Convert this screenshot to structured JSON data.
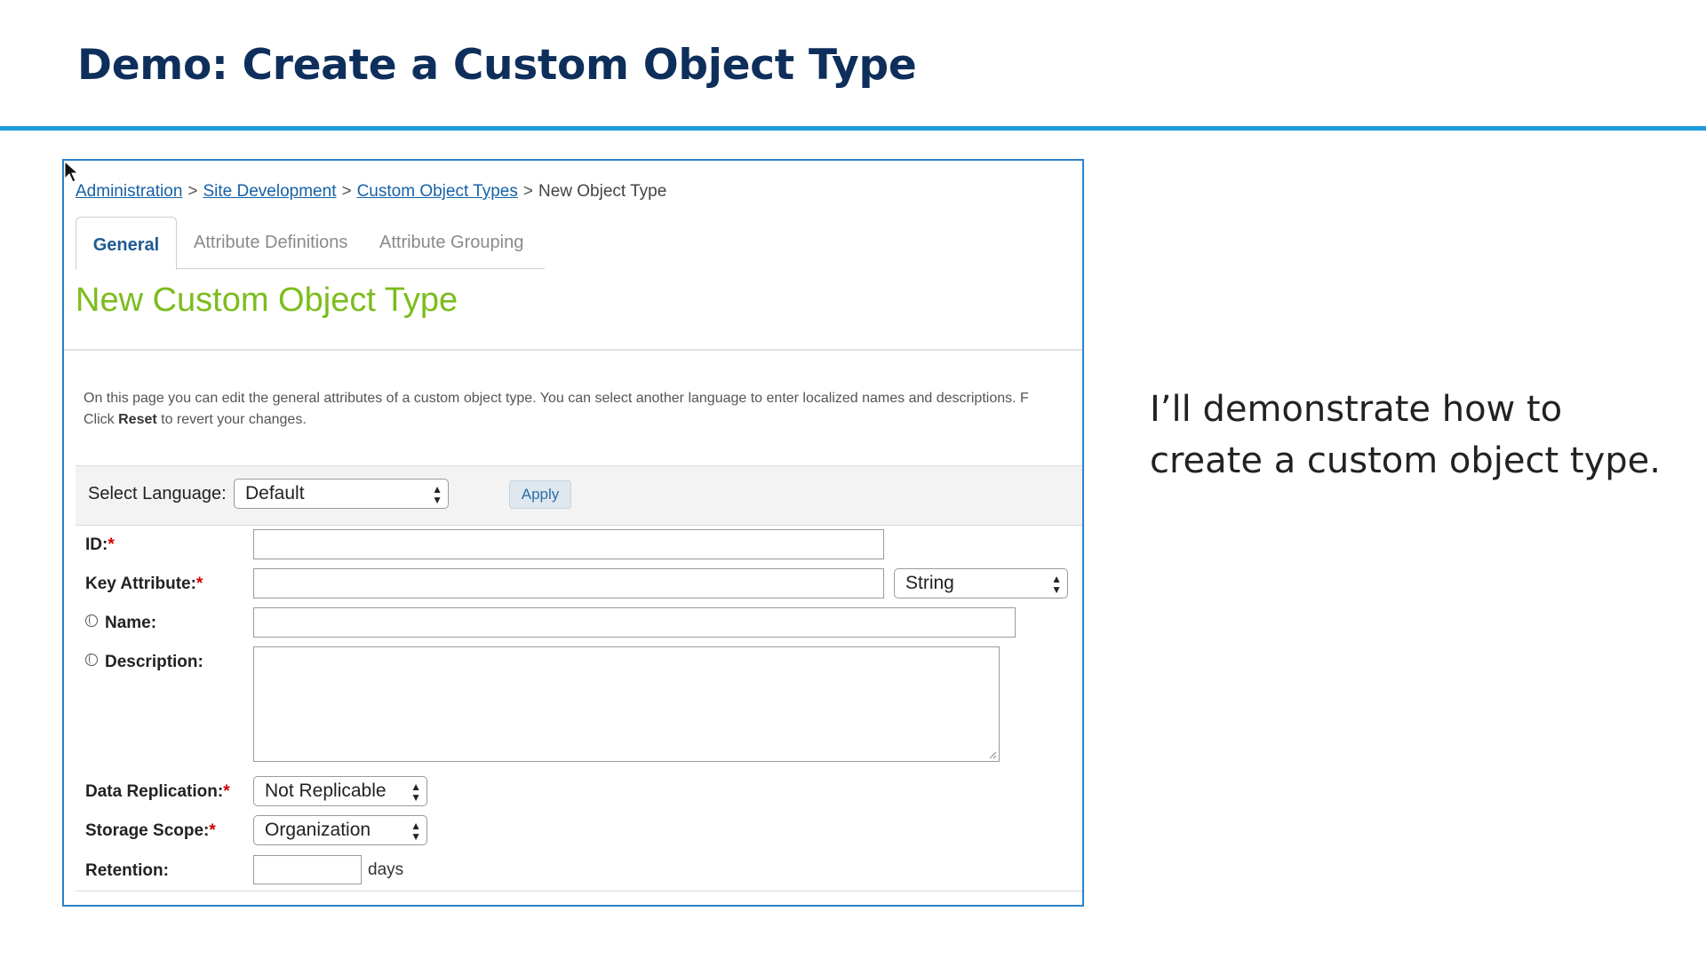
{
  "slide": {
    "title": "Demo: Create a Custom Object Type",
    "side_text": "I’ll demonstrate how to create a custom object type."
  },
  "breadcrumb": {
    "items": [
      "Administration",
      "Site Development",
      "Custom Object Types"
    ],
    "current": "New Object Type",
    "separator": ">"
  },
  "tabs": [
    {
      "label": "General"
    },
    {
      "label": "Attribute Definitions"
    },
    {
      "label": "Attribute Grouping"
    }
  ],
  "page": {
    "heading": "New Custom Object Type",
    "intro_line1": "On this page you can edit the general attributes of a custom object type. You can select another language to enter localized names and descriptions. F",
    "intro_line2_pre": "Click ",
    "intro_line2_bold": "Reset",
    "intro_line2_post": " to revert your changes."
  },
  "language": {
    "label": "Select Language:",
    "selected": "Default",
    "apply_label": "Apply"
  },
  "form": {
    "id_label": "ID:",
    "key_label": "Key Attribute:",
    "key_type": "String",
    "name_label": "Name:",
    "description_label": "Description:",
    "replication_label": "Data Replication:",
    "replication_value": "Not Replicable",
    "scope_label": "Storage Scope:",
    "scope_value": "Organization",
    "retention_label": "Retention:",
    "retention_unit": "days",
    "required_mark": "*"
  },
  "colors": {
    "title": "#0e2f5c",
    "rule": "#1e9ad8",
    "frame": "#2a82cc",
    "heading_green": "#7bbd1b",
    "link": "#1561a8",
    "required": "#d40000"
  }
}
